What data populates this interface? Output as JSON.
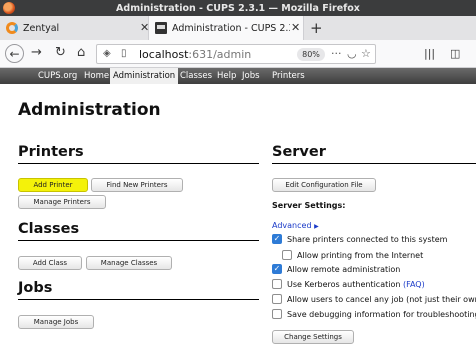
{
  "window": {
    "title": "Administration - CUPS 2.3.1 — Mozilla Firefox"
  },
  "tabs": [
    {
      "label": "Zentyal",
      "icon": "zentyal-icon"
    },
    {
      "label": "Administration - CUPS 2.3.1",
      "icon": "cups-printer-icon"
    }
  ],
  "urlbar": {
    "host": "localhost",
    "rest": ":631/admin",
    "zoom": "80%"
  },
  "cups_menu": [
    "CUPS.org",
    "Home",
    "Administration",
    "Classes",
    "Help",
    "Jobs",
    "Printers"
  ],
  "page": {
    "title": "Administration",
    "printers": {
      "heading": "Printers",
      "add_printer": "Add Printer",
      "find_new_printers": "Find New Printers",
      "manage_printers": "Manage Printers"
    },
    "classes": {
      "heading": "Classes",
      "add_class": "Add Class",
      "manage_classes": "Manage Classes"
    },
    "jobs": {
      "heading": "Jobs",
      "manage_jobs": "Manage Jobs"
    },
    "server": {
      "heading": "Server",
      "edit_config": "Edit Configuration File",
      "settings_label": "Server Settings:",
      "advanced": "Advanced",
      "options": [
        {
          "label": "Share printers connected to this system",
          "checked": true
        },
        {
          "label": "Allow printing from the Internet",
          "checked": false
        },
        {
          "label": "Allow remote administration",
          "checked": true
        },
        {
          "label": "Use Kerberos authentication",
          "link": "(FAQ)",
          "checked": false
        },
        {
          "label": "Allow users to cancel any job (not just their own)",
          "checked": false
        },
        {
          "label": "Save debugging information for troubleshooting",
          "checked": false
        }
      ],
      "change_settings": "Change Settings"
    }
  },
  "colors": {
    "highlight": "#f4f20a",
    "checkbox_checked": "#2e7bd6",
    "link": "#1a3ac8",
    "menubar": "#4a4a4a"
  }
}
